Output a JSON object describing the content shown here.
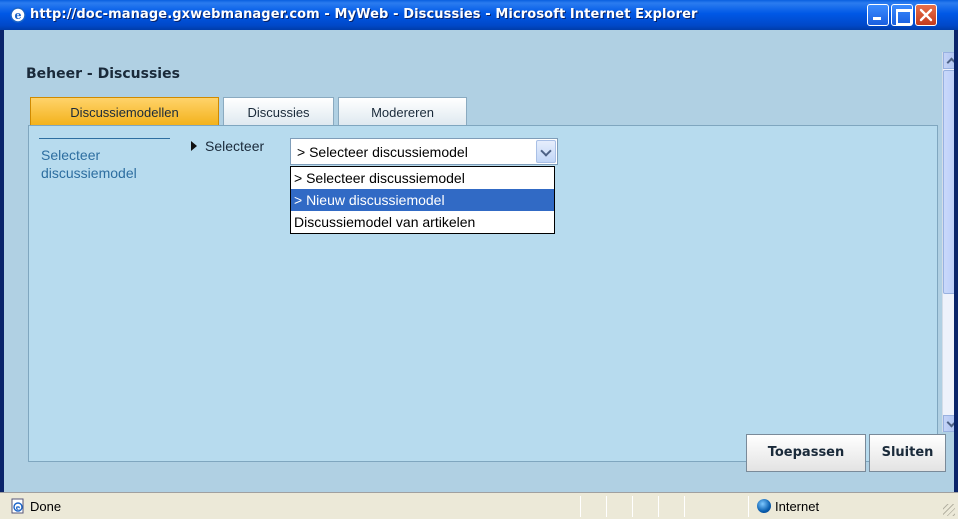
{
  "window": {
    "title": "http://doc-manage.gxwebmanager.com - MyWeb - Discussies - Microsoft Internet Explorer"
  },
  "page": {
    "title": "Beheer - Discussies",
    "tabs": [
      {
        "label": "Discussiemodellen",
        "active": true
      },
      {
        "label": "Discussies",
        "active": false
      },
      {
        "label": "Modereren",
        "active": false
      }
    ],
    "sidebar": {
      "link": "Selecteer discussiemodel"
    },
    "selector": {
      "label": "Selecteer",
      "value": "> Selecteer discussiemodel",
      "options": [
        "> Selecteer discussiemodel",
        "> Nieuw discussiemodel",
        "Discussiemodel van artikelen"
      ],
      "highlighted_index": 1
    },
    "buttons": {
      "apply": "Toepassen",
      "close": "Sluiten"
    }
  },
  "statusbar": {
    "status": "Done",
    "zone": "Internet"
  },
  "colors": {
    "accent_tab": "#f3b21c",
    "selection": "#316ac5",
    "link": "#2d6ea0"
  }
}
